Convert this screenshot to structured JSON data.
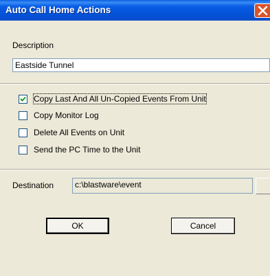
{
  "window": {
    "title": "Auto Call Home Actions"
  },
  "description": {
    "label": "Description",
    "value": "Eastside Tunnel"
  },
  "options": [
    {
      "label": "Copy Last And All Un-Copied Events From Unit",
      "checked": true
    },
    {
      "label": "Copy Monitor Log",
      "checked": false
    },
    {
      "label": "Delete All Events on Unit",
      "checked": false
    },
    {
      "label": "Send the PC Time to the Unit",
      "checked": false
    }
  ],
  "destination": {
    "label": "Destination",
    "value": "c:\\blastware\\event"
  },
  "buttons": {
    "ok": "OK",
    "cancel": "Cancel"
  },
  "icons": {
    "close": "close-icon",
    "check": "checkmark-icon"
  },
  "colors": {
    "titlebar": "#0a5ee5",
    "close": "#d9542a",
    "face": "#ece9d8"
  }
}
